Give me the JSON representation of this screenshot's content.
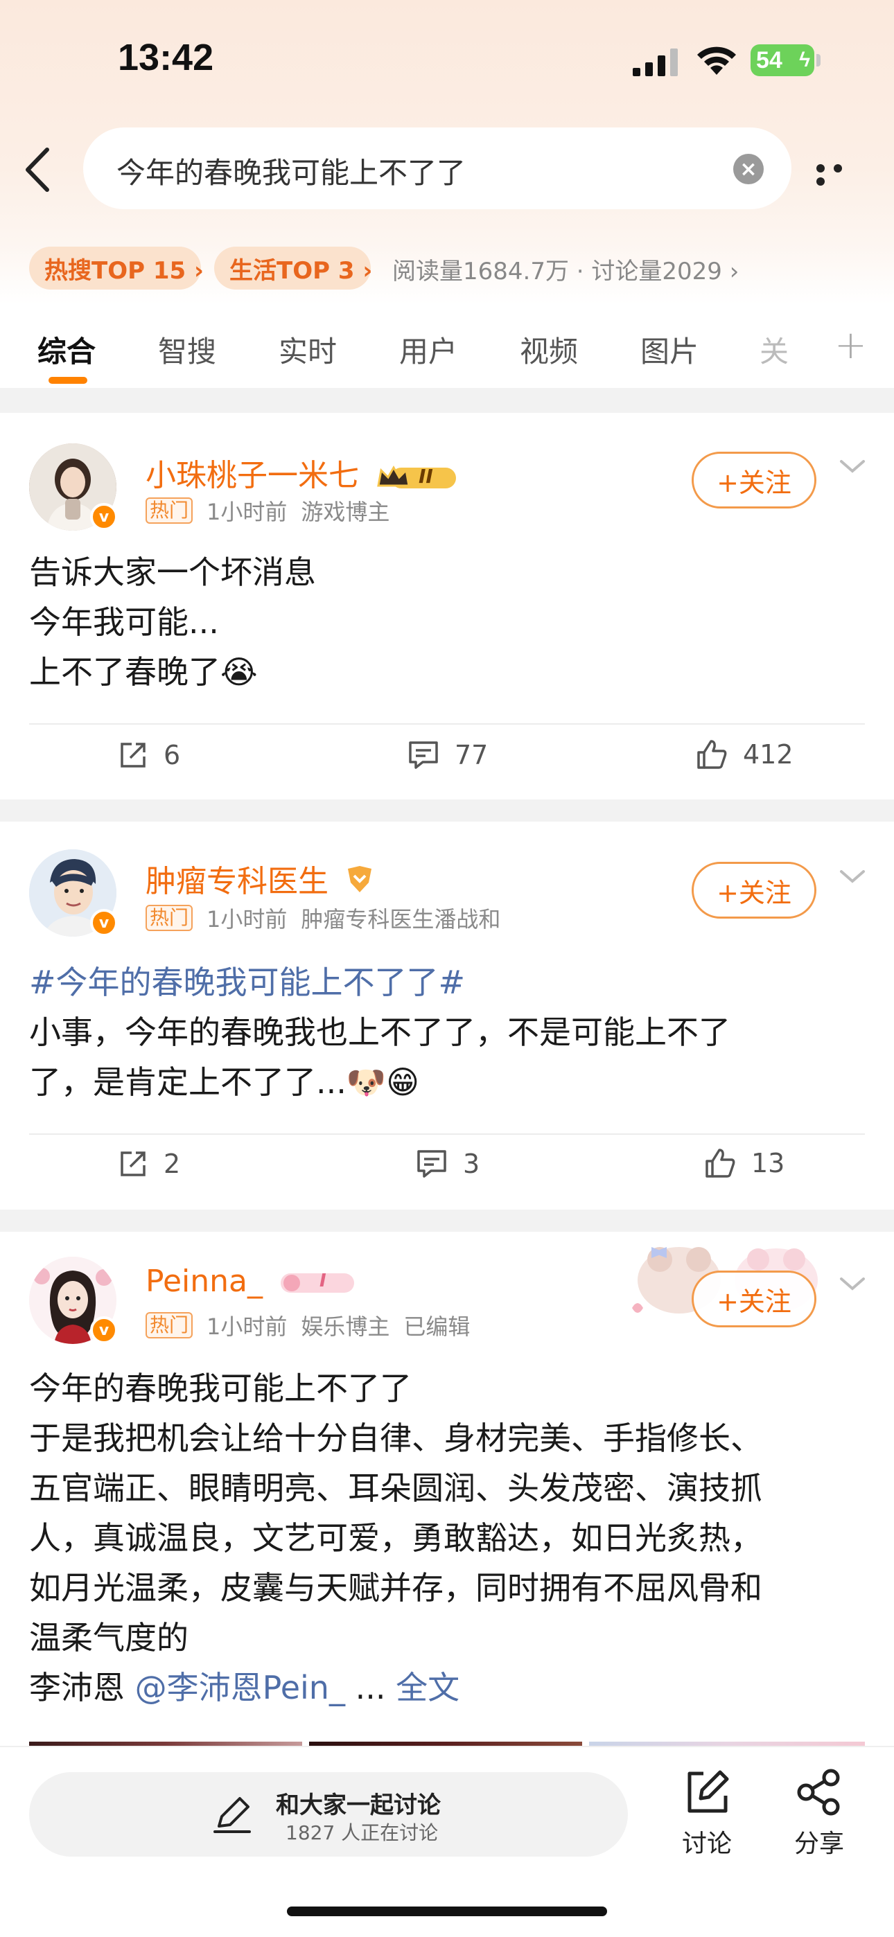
{
  "status": {
    "time": "13:42",
    "battery": "54"
  },
  "search": {
    "query": "今年的春晚我可能上不了了"
  },
  "trending": {
    "hot_chip": "热搜TOP 15 ›",
    "life_chip": "生活TOP 3 ›",
    "stats": "阅读量1684.7万 · 讨论量2029 ›"
  },
  "tabs": [
    "综合",
    "智搜",
    "实时",
    "用户",
    "视频",
    "图片",
    "关"
  ],
  "posts": [
    {
      "username": "小珠桃子一米七",
      "level": "II",
      "hot_tag": "热门",
      "time": "1小时前",
      "source": "游戏博主",
      "follow": "+关注",
      "lines": [
        "告诉大家一个坏消息",
        "今年我可能...",
        "上不了春晚了😭"
      ],
      "reposts": "6",
      "comments": "77",
      "likes": "412"
    },
    {
      "username": "肿瘤专科医生",
      "hot_tag": "热门",
      "time": "1小时前",
      "source": "肿瘤专科医生潘战和",
      "follow": "+关注",
      "topic": "#今年的春晚我可能上不了了#",
      "lines": [
        "小事，今年的春晚我也上不了了，不是可能上不了",
        "了，是肯定上不了了...🐶😁"
      ],
      "reposts": "2",
      "comments": "3",
      "likes": "13"
    },
    {
      "username": "Peinna_",
      "level": "I",
      "hot_tag": "热门",
      "time": "1小时前",
      "source": "娱乐博主",
      "edited": "已编辑",
      "follow": "+关注",
      "lines": [
        "今年的春晚我可能上不了了",
        "于是我把机会让给十分自律、身材完美、手指修长、",
        "五官端正、眼睛明亮、耳朵圆润、头发茂密、演技抓",
        "人，真诚温良，文艺可爱，勇敢豁达，如日光炙热，",
        "如月光温柔，皮囊与天赋并存，同时拥有不屈风骨和",
        "温柔气度的"
      ],
      "last_line_prefix": "李沛恩 ",
      "mention": "@李沛恩Pein_",
      "ellipsis": " ... ",
      "full_text": "全文"
    }
  ],
  "bottom_bar": {
    "pill_title": "和大家一起讨论",
    "pill_sub": "1827 人正在讨论",
    "discuss": "讨论",
    "share": "分享"
  },
  "colors": {
    "accent": "#ff8200",
    "username": "#f26d10",
    "topic_link": "#4f6ea8"
  }
}
